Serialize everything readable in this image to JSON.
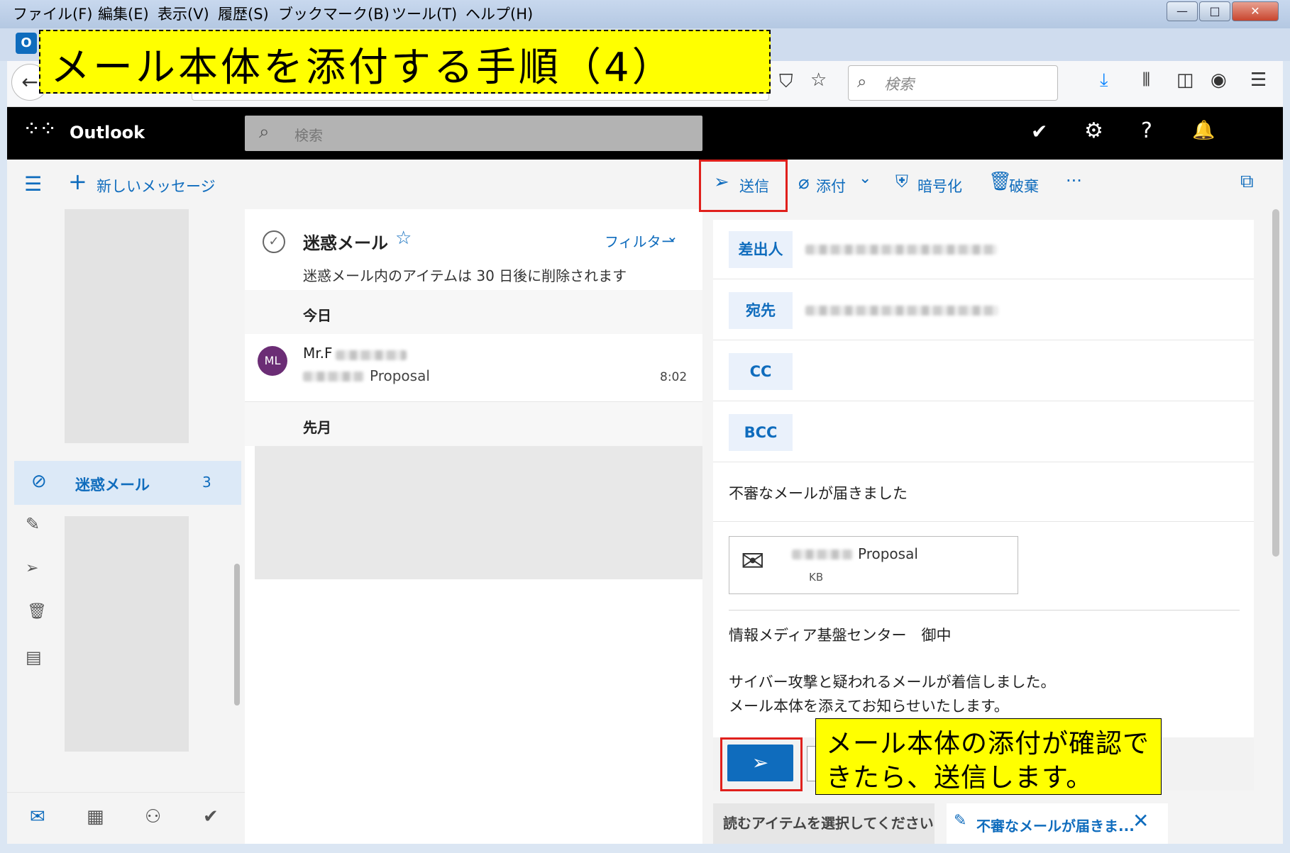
{
  "browser": {
    "menu": [
      "ファイル(F)",
      "編集(E)",
      "表示(V)",
      "履歴(S)",
      "ブックマーク(B)",
      "ツール(T)",
      "ヘルプ(H)"
    ],
    "search_placeholder": "検索"
  },
  "annotations": {
    "title": "メール本体を添付する手順（4）",
    "note_line1": "メール本体の添付が確認で",
    "note_line2": "きたら、送信します。"
  },
  "outlook": {
    "brand": "Outlook",
    "search_placeholder": "検索",
    "new_message": "新しいメッセージ",
    "toolbar": {
      "send": "送信",
      "attach": "添付",
      "encrypt": "暗号化",
      "discard": "破棄",
      "more": "···"
    },
    "nav": {
      "junk_label": "迷惑メール",
      "junk_count": "3"
    },
    "list": {
      "folder_title": "迷惑メール",
      "filter": "フィルター",
      "notice": "迷惑メール内のアイテムは 30 日後に削除されます",
      "group_today": "今日",
      "group_last_month": "先月",
      "message": {
        "avatar": "ML",
        "sender": "Mr.F",
        "subject": "Proposal",
        "time": "8:02"
      }
    },
    "compose": {
      "from_label": "差出人",
      "to_label": "宛先",
      "cc_label": "CC",
      "bcc_label": "BCC",
      "subject": "不審なメールが届きました",
      "attachment_name": "Proposal",
      "attachment_size": "KB",
      "body_line1": "情報メディア基盤センター　御中",
      "body_line2": "サイバー攻撃と疑われるメールが着信しました。",
      "body_line3": "メール本体を添えてお知らせいたします。"
    },
    "bottom_tabs": {
      "read_tab": "読むアイテムを選択してください",
      "draft_tab": "不審なメールが届きま..."
    }
  },
  "colors": {
    "accent": "#0f6cbd",
    "callout": "#ffff00",
    "highlight_box": "#e0201c",
    "avatar": "#6b2d75"
  }
}
